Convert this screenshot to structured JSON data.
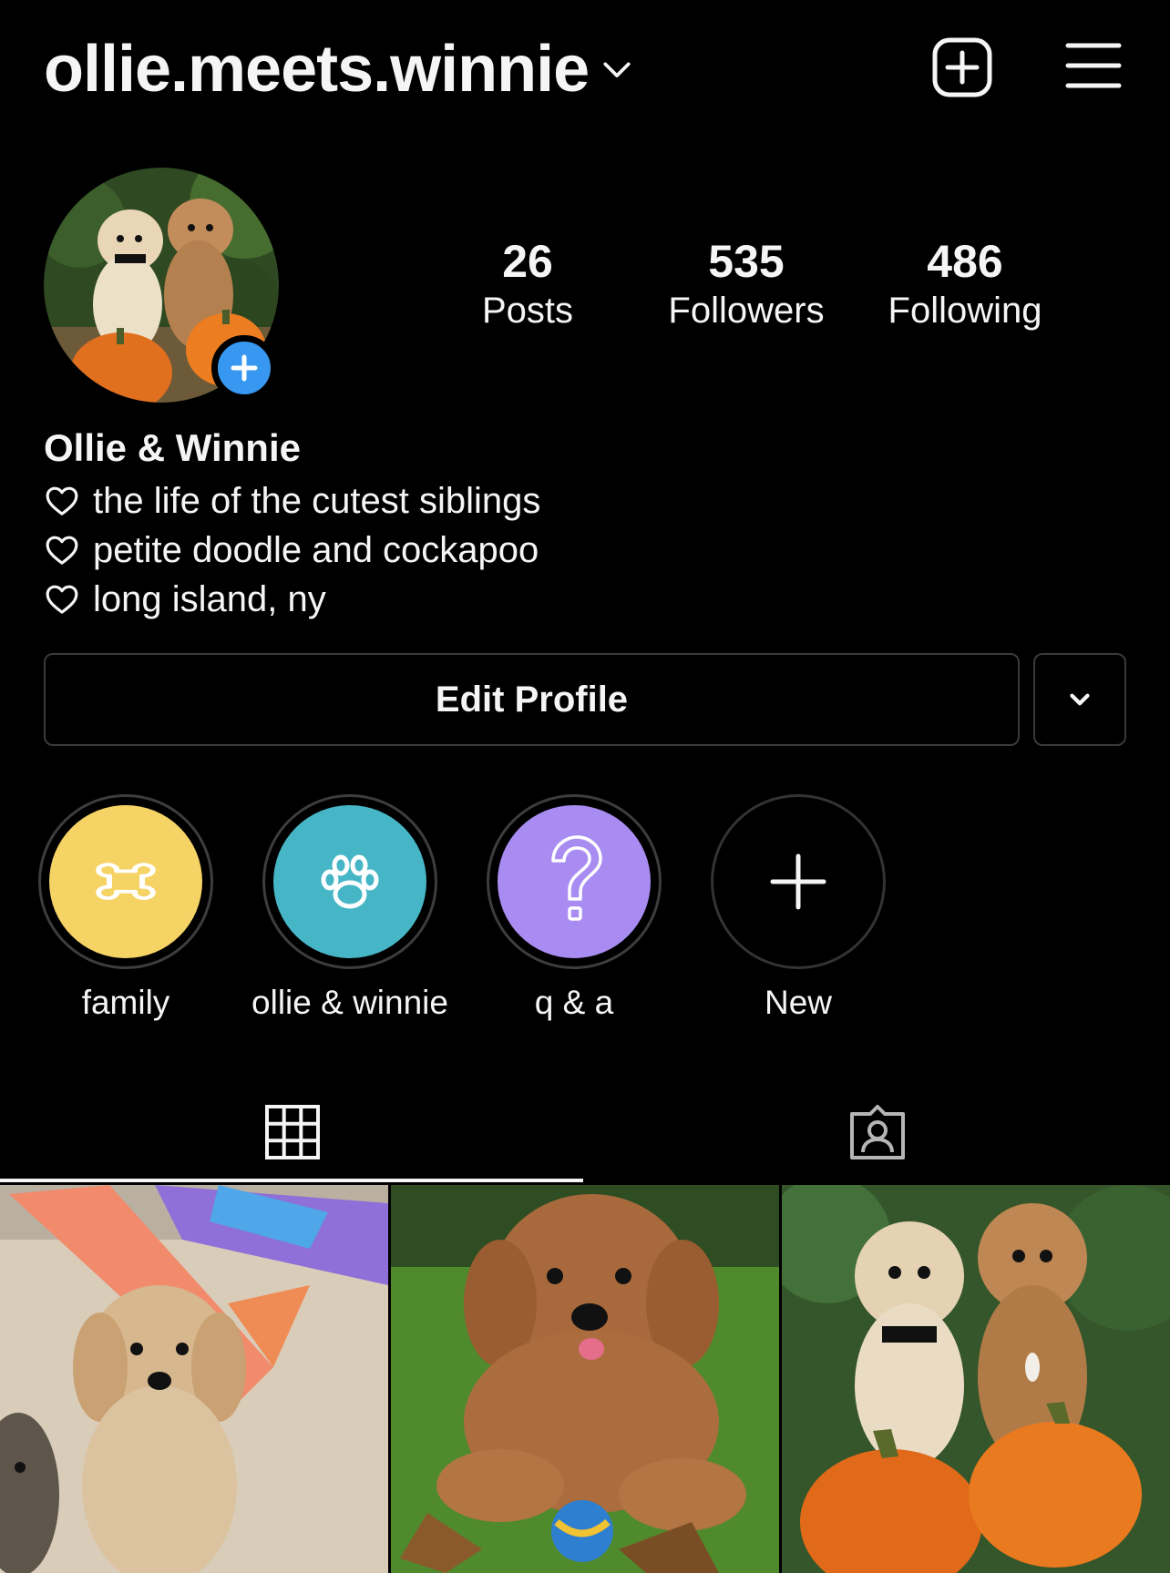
{
  "header": {
    "username": "ollie.meets.winnie",
    "icons": [
      "chevron-down-icon",
      "new-post-icon",
      "menu-icon"
    ]
  },
  "profile": {
    "stats": [
      {
        "value": "26",
        "label": "Posts"
      },
      {
        "value": "535",
        "label": "Followers"
      },
      {
        "value": "486",
        "label": "Following"
      }
    ],
    "display_name": "Ollie & Winnie",
    "bio": [
      "the life of the cutest siblings",
      "petite doodle and cockapoo",
      "long island, ny"
    ]
  },
  "buttons": {
    "edit_profile": "Edit Profile"
  },
  "highlights": [
    {
      "label": "family",
      "color": "#f6d365",
      "icon": "bone-icon"
    },
    {
      "label": "ollie & winnie",
      "color": "#46b6c6",
      "icon": "paw-icon"
    },
    {
      "label": "q & a",
      "color": "#a98cf2",
      "icon": "question-mark-icon"
    },
    {
      "label": "New",
      "color": "#000000",
      "icon": "plus-icon"
    }
  ],
  "tabs": [
    {
      "icon": "grid-icon",
      "selected": true
    },
    {
      "icon": "tagged-icon",
      "selected": false
    }
  ],
  "colors": {
    "background": "#000000",
    "text": "#f5f5f5",
    "accent": "#3897f0",
    "border": "#3a3a3a"
  }
}
